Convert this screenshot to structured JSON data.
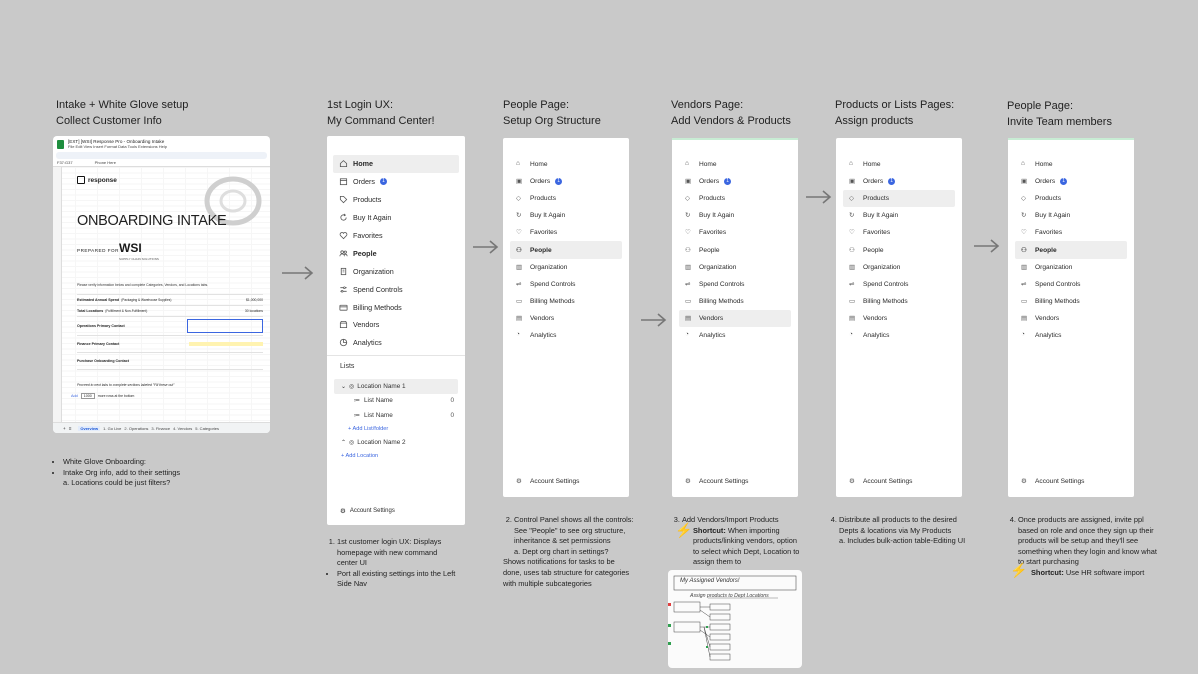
{
  "columns": [
    {
      "title_line1": "Intake + White Glove setup",
      "title_line2": "Collect Customer Info"
    },
    {
      "title_line1": "1st Login UX:",
      "title_line2": "My Command Center!"
    },
    {
      "title_line1": "People Page:",
      "title_line2": "Setup Org Structure"
    },
    {
      "title_line1": "Vendors Page:",
      "title_line2": "Add Vendors & Products"
    },
    {
      "title_line1": "Products or Lists Pages:",
      "title_line2": "Assign products"
    },
    {
      "title_line1": "People Page:",
      "title_line2": "Invite Team members"
    }
  ],
  "sheet": {
    "doc_title": "[EXT] [WSI] Response Pro - Onboarding Intake",
    "menu": "File  Edit  View  Insert  Format  Data  Tools  Extensions  Help",
    "cell_ref": "F37:G37",
    "fx": "Phone Here",
    "brand": "response",
    "heading": "ONBOARDING INTAKE",
    "prepared_for": "PREPARED FOR",
    "client_logo": "WSI",
    "client_tagline": "SUPPLY CHAIN SOLUTIONS",
    "instruction": "Please verify information below and complete Categories, Vendors, and Locations tabs.",
    "rows": [
      {
        "label": "Estimated Annual Spend",
        "detail": "(Packaging & Warehouse Supplies)",
        "value": "$1,000,000"
      },
      {
        "label": "Total Locations",
        "detail": "(Fulfillment & Non-Fulfillment)",
        "value": "30 locations"
      },
      {
        "label": "Operations Primary Contact",
        "detail": "",
        "value": ""
      },
      {
        "label": "Finance Primary Contact",
        "detail": "",
        "value": ""
      },
      {
        "label": "Purchase Onboarding Contact",
        "detail": "",
        "value": ""
      }
    ],
    "footer_note": "Proceed to next tabs to complete sections labeled \"Fill these out\"",
    "add_label": "Add",
    "add_value": "1000",
    "add_suffix": "more rows at the bottom",
    "tabs": [
      "Overview",
      "1. Go Live",
      "2. Operations",
      "3. Finance",
      "4. Vendors",
      "5. Categories"
    ]
  },
  "col1_notes": [
    "White Glove Onboarding:",
    "Intake Org info, add to their settings",
    "a. Locations could be just filters?"
  ],
  "big_panel": {
    "nav": [
      "Home",
      "Orders",
      "Products",
      "Buy It Again",
      "Favorites",
      "People",
      "Organization",
      "Spend Controls",
      "Billing Methods",
      "Vendors",
      "Analytics"
    ],
    "orders_badge": "1",
    "lists_heading": "Lists",
    "location1": "Location Name 1",
    "list1": "List Name",
    "list1_count": "0",
    "list2": "List Name",
    "list2_count": "0",
    "add_list": "+ Add List/folder",
    "location2": "Location Name 2",
    "add_location": "+ Add Location",
    "account": "Account Settings"
  },
  "col2_notes": [
    "1st customer login UX: Displays homepage with new command center UI",
    "Port all existing settings into the Left Side Nav"
  ],
  "small_nav": [
    "Home",
    "Orders",
    "Products",
    "Buy It Again",
    "Favorites",
    "People",
    "Organization",
    "Spend Controls",
    "Billing Methods",
    "Vendors",
    "Analytics"
  ],
  "orders_badge": "1",
  "account_label": "Account Settings",
  "col3_notes": {
    "main": "Control Panel shows all the controls: See \"People\" to see org structure, inheritance & set permissions",
    "sub": "a. Dept org chart in settings?",
    "extra": "Shows notifications for tasks to be done, uses tab structure for categories with multiple subcategories"
  },
  "col4_notes": {
    "main": "Add Vendors/Import Products",
    "shortcut_label": "Shortcut:",
    "shortcut_text": "When importing products/linking vendors, option to select which Dept, Location to assign them to"
  },
  "sketch": {
    "line1": "My Assigned Vendors!",
    "line2": "Assign products to Dept Locations"
  },
  "col5_notes": {
    "main": "Distribute all products to the desired Depts & locations via My Products",
    "sub": "a. Includes bulk-action table-Editing UI"
  },
  "col6_notes": {
    "main": "Once products are assigned, invite ppl based on role and once they sign up their products will be setup and they'll see something when they login and know what to start purchasing",
    "shortcut_label": "Shortcut:",
    "shortcut_text": "Use HR software import"
  },
  "colors": {
    "background": "#c9c9c9",
    "accent": "#3b66e0",
    "active_row": "#eeeeee"
  }
}
